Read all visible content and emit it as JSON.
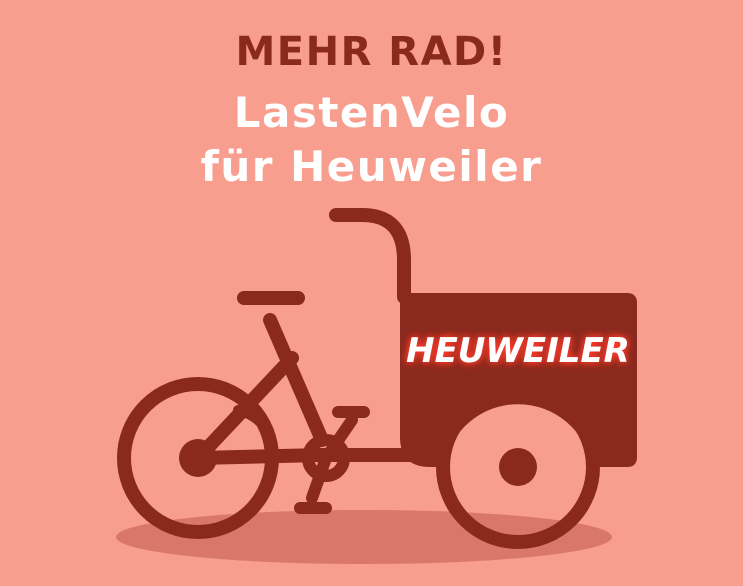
{
  "poster": {
    "slogan": "MEHR RAD!",
    "title_line1": "LastenVelo",
    "title_line2": "für Heuweiler",
    "box_label": "HEUWEILER"
  },
  "colors": {
    "background": "#f89e8f",
    "bike": "#8a2a1f",
    "shadow": "#d9776b",
    "title_text": "#ffffff",
    "label_text": "#ffffff",
    "label_glow": "#ff3b2a"
  },
  "icons": {
    "illustration": "cargo-bike-icon"
  }
}
